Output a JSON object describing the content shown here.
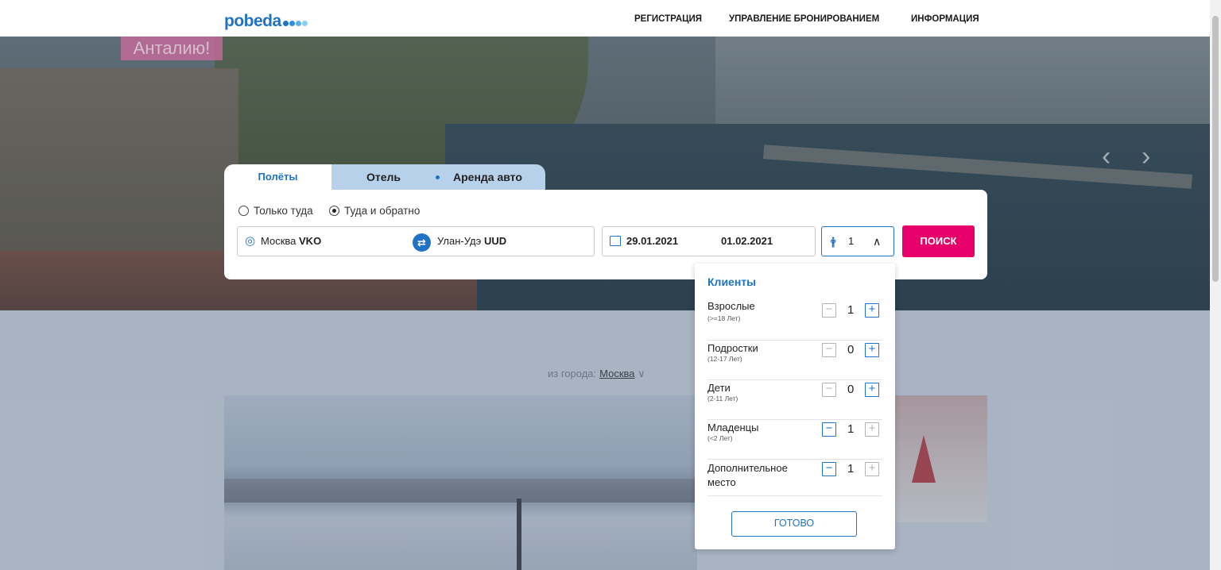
{
  "header": {
    "logo": "pobeda",
    "nav": [
      "РЕГИСТРАЦИЯ",
      "УПРАВЛЕНИЕ БРОНИРОВАНИЕМ",
      "ИНФОРМАЦИЯ"
    ]
  },
  "hero": {
    "banner": "Анталию!"
  },
  "tabs": {
    "flights": "Полёты",
    "hotel": "Отель",
    "car": "Аренда авто"
  },
  "trip_type": {
    "one_way": "Только туда",
    "round_trip": "Туда и обратно",
    "selected": "round_trip"
  },
  "search": {
    "from_city": "Москва",
    "from_code": "VKO",
    "to_city": "Улан-Удэ",
    "to_code": "UUD",
    "depart": "29.01.2021",
    "return": "01.02.2021",
    "passengers": "1",
    "button": "ПОИСК"
  },
  "passengers_dropdown": {
    "title": "Клиенты",
    "rows": [
      {
        "label": "Взрослые",
        "sub": "(>=18 Лет)",
        "count": "1",
        "minus_enabled": false,
        "plus_enabled": true
      },
      {
        "label": "Подростки",
        "sub": "(12-17 Лет)",
        "count": "0",
        "minus_enabled": false,
        "plus_enabled": true
      },
      {
        "label": "Дети",
        "sub": "(2-11 Лет)",
        "count": "0",
        "minus_enabled": false,
        "plus_enabled": true
      },
      {
        "label": "Младенцы",
        "sub": "(<2 Лет)",
        "count": "1",
        "minus_enabled": true,
        "plus_enabled": false
      },
      {
        "label": "Дополнительное место",
        "sub": "",
        "count": "1",
        "minus_enabled": true,
        "plus_enabled": false
      }
    ],
    "done": "ГОТОВО"
  },
  "lower": {
    "from_label": "из города:",
    "from_city": "Москва"
  },
  "colors": {
    "brand_blue": "#1f72c4",
    "search_pink": "#e8006a",
    "tab_light": "#b8d1ea"
  }
}
